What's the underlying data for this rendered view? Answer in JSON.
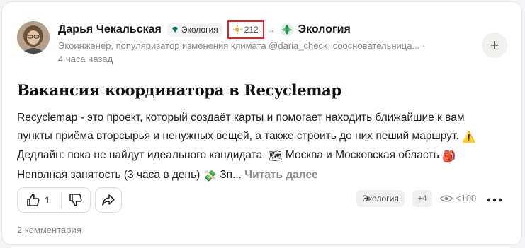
{
  "author": {
    "name": "Дарья Чекальская",
    "badge": "Экология",
    "karma": "212",
    "channel": "Экология",
    "description": "Экоинженер, популяризатор изменения климата @daria_check, сооснователь­ница... ·",
    "time": "4 часа назад"
  },
  "post": {
    "title": "Вакансия координатора в Recyclemap",
    "line1": "Recyclemap - это проект, который создаёт карты и помогает находить ближайшие к вам",
    "line2": "пункты приёма вторсырья и ненужных вещей, а также строить до них пеший маршрут.",
    "emoji_warning": "⚠️",
    "line3": "Дедлайн: пока не найдут идеального кандидата.",
    "emoji_map": "🗺",
    "line3b": "Москва и Московская область",
    "emoji_bag": "🎒",
    "line4": "Неполная занятость (3 часа в день)",
    "emoji_money": "💸",
    "line4b": "Зп...",
    "read_more": "Читать далее"
  },
  "footer": {
    "likes": "1",
    "tag": "Экология",
    "more_tags": "+4",
    "views": "<100",
    "comments": "2 комментария"
  },
  "icons": {
    "badge": "gem-icon",
    "karma": "sun-icon",
    "arrow": "arrow-right-icon",
    "channel": "leaf-icon",
    "plus": "plus-icon",
    "like": "thumbs-up-icon",
    "dislike": "thumbs-down-icon",
    "share": "share-icon",
    "views": "eye-icon",
    "more": "more-dots-icon"
  },
  "colors": {
    "highlight": "#e8202a",
    "muted": "#8a8a8e",
    "badge_gem": "#1b6b55"
  }
}
